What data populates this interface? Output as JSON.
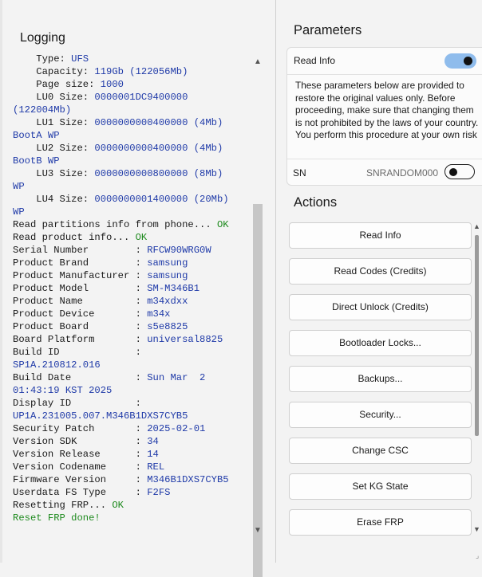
{
  "logging": {
    "title": "Logging",
    "lines": [
      [
        {
          "t": "    Type: ",
          "c": "info"
        },
        {
          "t": "UFS",
          "c": "val"
        }
      ],
      [
        {
          "t": "    Capacity: ",
          "c": "info"
        },
        {
          "t": "119Gb (122056Mb)",
          "c": "val"
        }
      ],
      [
        {
          "t": "    Page size: ",
          "c": "info"
        },
        {
          "t": "1000",
          "c": "val"
        }
      ],
      [
        {
          "t": "    LU0 Size: ",
          "c": "info"
        },
        {
          "t": "0000001DC9400000",
          "c": "val"
        }
      ],
      [
        {
          "t": "(122004Mb)",
          "c": "val"
        }
      ],
      [
        {
          "t": "    LU1 Size: ",
          "c": "info"
        },
        {
          "t": "0000000000400000 (4Mb)",
          "c": "val"
        }
      ],
      [
        {
          "t": "BootA WP",
          "c": "val"
        }
      ],
      [
        {
          "t": "    LU2 Size: ",
          "c": "info"
        },
        {
          "t": "0000000000400000 (4Mb)",
          "c": "val"
        }
      ],
      [
        {
          "t": "BootB WP",
          "c": "val"
        }
      ],
      [
        {
          "t": "    LU3 Size: ",
          "c": "info"
        },
        {
          "t": "0000000000800000 (8Mb)",
          "c": "val"
        }
      ],
      [
        {
          "t": "WP",
          "c": "val"
        }
      ],
      [
        {
          "t": "    LU4 Size: ",
          "c": "info"
        },
        {
          "t": "0000000001400000 (20Mb)",
          "c": "val"
        }
      ],
      [
        {
          "t": "WP",
          "c": "val"
        }
      ],
      [
        {
          "t": "Read partitions info from phone... ",
          "c": "info"
        },
        {
          "t": "OK",
          "c": "ok"
        }
      ],
      [
        {
          "t": "Read product info... ",
          "c": "info"
        },
        {
          "t": "OK",
          "c": "ok"
        }
      ],
      [
        {
          "t": "Serial Number        : ",
          "c": "info"
        },
        {
          "t": "RFCW90WRG0W",
          "c": "val"
        }
      ],
      [
        {
          "t": "Product Brand        : ",
          "c": "info"
        },
        {
          "t": "samsung",
          "c": "val"
        }
      ],
      [
        {
          "t": "Product Manufacturer : ",
          "c": "info"
        },
        {
          "t": "samsung",
          "c": "val"
        }
      ],
      [
        {
          "t": "Product Model        : ",
          "c": "info"
        },
        {
          "t": "SM-M346B1",
          "c": "val"
        }
      ],
      [
        {
          "t": "Product Name         : ",
          "c": "info"
        },
        {
          "t": "m34xdxx",
          "c": "val"
        }
      ],
      [
        {
          "t": "Product Device       : ",
          "c": "info"
        },
        {
          "t": "m34x",
          "c": "val"
        }
      ],
      [
        {
          "t": "Product Board        : ",
          "c": "info"
        },
        {
          "t": "s5e8825",
          "c": "val"
        }
      ],
      [
        {
          "t": "Board Platform       : ",
          "c": "info"
        },
        {
          "t": "universal8825",
          "c": "val"
        }
      ],
      [
        {
          "t": "Build ID             :",
          "c": "info"
        }
      ],
      [
        {
          "t": "SP1A.210812.016",
          "c": "val"
        }
      ],
      [
        {
          "t": "Build Date           : ",
          "c": "info"
        },
        {
          "t": "Sun Mar  2",
          "c": "val"
        }
      ],
      [
        {
          "t": "01:43:19 KST 2025",
          "c": "val"
        }
      ],
      [
        {
          "t": "Display ID           :",
          "c": "info"
        }
      ],
      [
        {
          "t": "UP1A.231005.007.M346B1DXS7CYB5",
          "c": "val"
        }
      ],
      [
        {
          "t": "Security Patch       : ",
          "c": "info"
        },
        {
          "t": "2025-02-01",
          "c": "val"
        }
      ],
      [
        {
          "t": "Version SDK          : ",
          "c": "info"
        },
        {
          "t": "34",
          "c": "val"
        }
      ],
      [
        {
          "t": "Version Release      : ",
          "c": "info"
        },
        {
          "t": "14",
          "c": "val"
        }
      ],
      [
        {
          "t": "Version Codename     : ",
          "c": "info"
        },
        {
          "t": "REL",
          "c": "val"
        }
      ],
      [
        {
          "t": "Firmware Version     : ",
          "c": "info"
        },
        {
          "t": "M346B1DXS7CYB5",
          "c": "val"
        }
      ],
      [
        {
          "t": "Userdata FS Type     : ",
          "c": "info"
        },
        {
          "t": "F2FS",
          "c": "val"
        }
      ],
      [
        {
          "t": "Resetting FRP... ",
          "c": "info"
        },
        {
          "t": "OK",
          "c": "ok"
        }
      ],
      [
        {
          "t": "Reset FRP done!",
          "c": "ok"
        }
      ]
    ]
  },
  "parameters": {
    "title": "Parameters",
    "read_info_label": "Read Info",
    "read_info_enabled": true,
    "disclaimer": "These parameters below are provided to restore the original values only. Before proceeding, make sure that changing them is not prohibited by the laws of your country. You perform this procedure at your own risk",
    "sn_label": "SN",
    "sn_value": "SNRANDOM000",
    "sn_enabled": false
  },
  "actions": {
    "title": "Actions",
    "buttons": [
      "Read Info",
      "Read Codes (Credits)",
      "Direct Unlock (Credits)",
      "Bootloader Locks...",
      "Backups...",
      "Security...",
      "Change CSC",
      "Set KG State",
      "Erase FRP"
    ]
  },
  "colors": {
    "log_value": "#1f3aa8",
    "log_ok": "#1e8a1e",
    "toggle_on": "#8fbcec"
  }
}
